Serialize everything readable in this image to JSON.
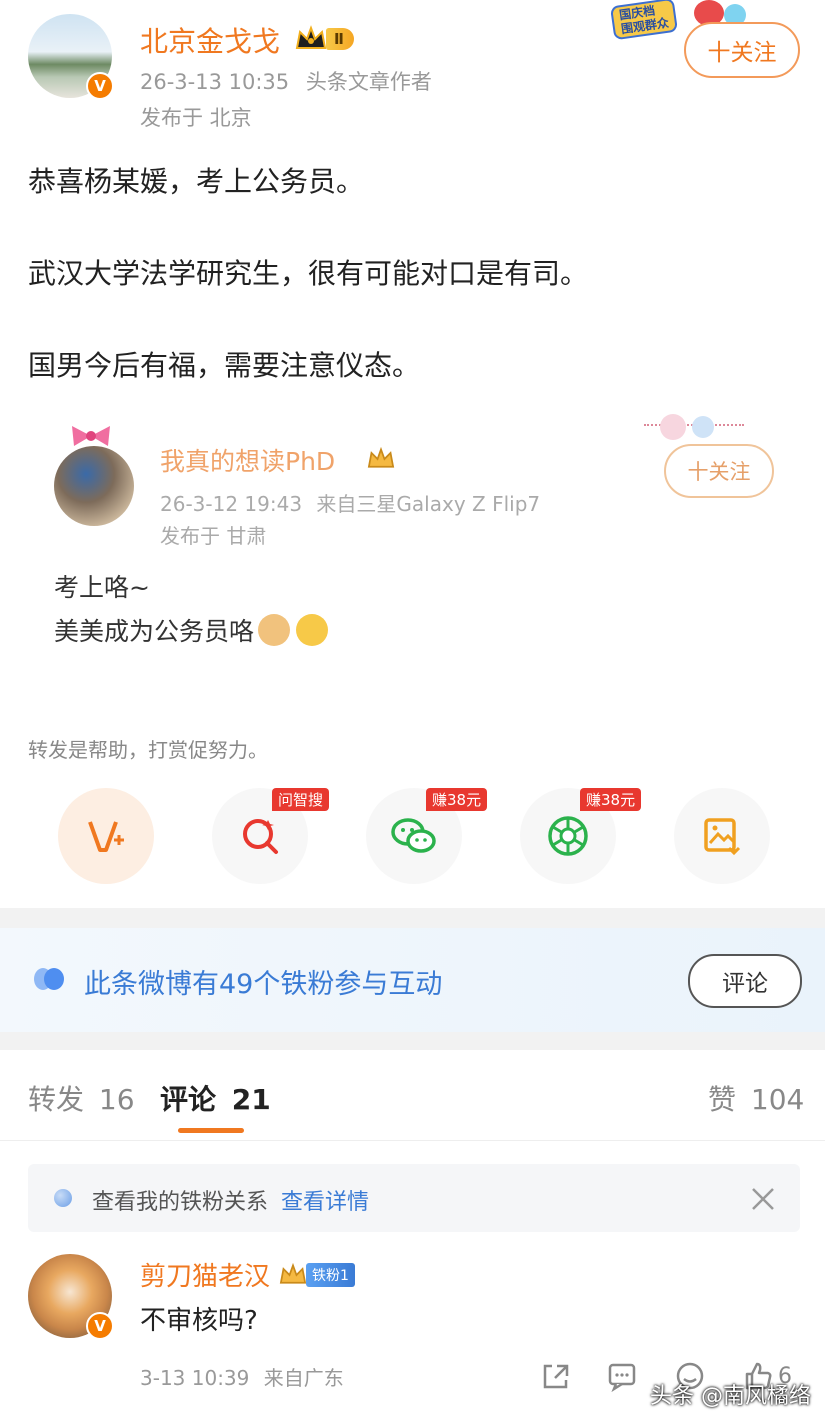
{
  "post": {
    "author": "北京金戈戈",
    "level_badge": "Ⅱ",
    "time": "26-3-13 10:35",
    "role": "头条文章作者",
    "location": "发布于 北京",
    "follow_label": "十关注",
    "lines": [
      "恭喜杨某媛，考上公务员。",
      "武汉大学法学研究生，很有可能对口是有司。",
      "国男今后有福，需要注意仪态。"
    ],
    "corner_badge": [
      "国庆档",
      "围观群众"
    ]
  },
  "quote": {
    "author": "我真的想读PhD",
    "time": "26-3-12 19:43",
    "device": "来自三星Galaxy Z Flip7",
    "location": "发布于 甘肃",
    "follow_label": "十关注",
    "lines": [
      "考上咯~",
      "美美成为公务员咯"
    ]
  },
  "share": {
    "hint": "转发是帮助，打赏促努力。",
    "items": [
      {
        "name": "weibo-repost-icon",
        "tag": ""
      },
      {
        "name": "search-ai-icon",
        "tag": "问智搜"
      },
      {
        "name": "wechat-icon",
        "tag": "赚38元"
      },
      {
        "name": "moments-icon",
        "tag": "赚38元"
      },
      {
        "name": "save-image-icon",
        "tag": ""
      }
    ]
  },
  "fans_banner": {
    "text": "此条微博有49个铁粉参与互动",
    "button": "评论"
  },
  "tabs": {
    "repost_label": "转发",
    "repost_count": "16",
    "comment_label": "评论",
    "comment_count": "21",
    "like_label": "赞",
    "like_count": "104"
  },
  "notice": {
    "text": "查看我的铁粉关系",
    "link": "查看详情"
  },
  "comment": {
    "author": "剪刀猫老汉",
    "fan_badge": "铁粉1",
    "text": "不审核吗?",
    "time": "3-13 10:39",
    "location": "来自广东",
    "like_count": "6"
  },
  "watermark": "头条 @南风橘络",
  "colors": {
    "accent": "#f07820",
    "link": "#3a7bd5",
    "red": "#e8382f"
  }
}
